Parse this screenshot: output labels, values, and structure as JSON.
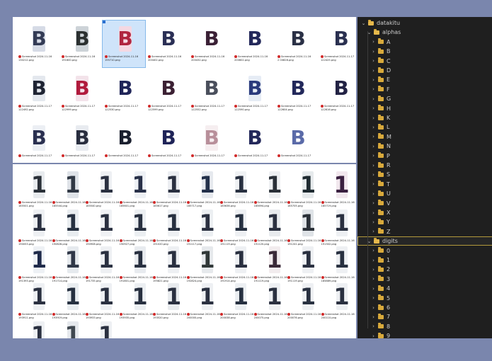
{
  "explorer": {
    "top_pane": {
      "rows": [
        {
          "items": [
            {
              "glyph": "B",
              "caption": [
                "Screenshot 2024-11-16",
                "130212.png"
              ],
              "bg": "#d6dbe6",
              "fg": "#333b55"
            },
            {
              "glyph": "B",
              "caption": [
                "Screenshot 2024-11-16",
                "191600.png"
              ],
              "bg": "#cdd3d8",
              "fg": "#2b3030"
            },
            {
              "glyph": "B",
              "caption": [
                "Screenshot 2024-11-16",
                "195710.png"
              ],
              "bg": "#f4d8e2",
              "fg": "#b0243f"
            },
            {
              "glyph": "B",
              "caption": [
                "Screenshot 2024-11-16",
                "200402.png"
              ],
              "bg": "#ffffff",
              "fg": "#2a2f55"
            },
            {
              "glyph": "B",
              "caption": [
                "Screenshot 2024-11-16",
                "200432.png"
              ],
              "bg": "#ffffff",
              "fg": "#3a2035"
            },
            {
              "glyph": "B",
              "caption": [
                "Screenshot 2024-11-16",
                "200602.png"
              ],
              "bg": "#ffffff",
              "fg": "#23285a"
            },
            {
              "glyph": "B",
              "caption": [
                "Screenshot 2024-11-16",
                "2 00828.png"
              ],
              "bg": "#ffffff",
              "fg": "#2a3045"
            },
            {
              "glyph": "B",
              "caption": [
                "Screenshot 2024-11-17",
                "122425.png"
              ],
              "bg": "#ffffff",
              "fg": "#2a3050"
            }
          ]
        },
        {
          "items": [
            {
              "glyph": "B",
              "caption": [
                "Screenshot 2024-11-17",
                "122492.png"
              ],
              "bg": "#e4e8ee",
              "fg": "#1f2433"
            },
            {
              "glyph": "B",
              "caption": [
                "Screenshot 2024-11-17",
                "122999.png"
              ],
              "bg": "#f3e3ea",
              "fg": "#b01a3c"
            },
            {
              "glyph": "B",
              "caption": [
                "Screenshot 2024-11-17",
                "122530.png"
              ],
              "bg": "#ffffff",
              "fg": "#1f2458"
            },
            {
              "glyph": "B",
              "caption": [
                "Screenshot 2024-11-17",
                "122599.png"
              ],
              "bg": "#ffffff",
              "fg": "#3b2033"
            },
            {
              "glyph": "B",
              "caption": [
                "Screenshot 2024-11-17",
                "122552.png"
              ],
              "bg": "#ffffff",
              "fg": "#4a4f5c"
            },
            {
              "glyph": "B",
              "caption": [
                "Screenshot 2024-11-17",
                "122590.png"
              ],
              "bg": "#e6ecf5",
              "fg": "#2a3a7c"
            },
            {
              "glyph": "B",
              "caption": [
                "Screenshot 2024-11-17",
                "122604.png"
              ],
              "bg": "#ffffff",
              "fg": "#22285a"
            },
            {
              "glyph": "B",
              "caption": [
                "Screenshot 2024-11-17",
                "122616.png"
              ],
              "bg": "#ffffff",
              "fg": "#222244"
            }
          ]
        },
        {
          "items": [
            {
              "glyph": "B",
              "caption": [
                "Screenshot 2024-11-17",
                ""
              ],
              "bg": "#eceff4",
              "fg": "#2a3050"
            },
            {
              "glyph": "B",
              "caption": [
                "Screenshot 2024-11-17",
                ""
              ],
              "bg": "#e8ebf0",
              "fg": "#282d3e"
            },
            {
              "glyph": "B",
              "caption": [
                "Screenshot 2024-11-17",
                ""
              ],
              "bg": "#ffffff",
              "fg": "#1a1f2e"
            },
            {
              "glyph": "B",
              "caption": [
                "Screenshot 2024-11-17",
                ""
              ],
              "bg": "#ffffff",
              "fg": "#1f2458"
            },
            {
              "glyph": "B",
              "caption": [
                "Screenshot 2024-11-17",
                ""
              ],
              "bg": "#f6eef0",
              "fg": "#b88f9a"
            },
            {
              "glyph": "B",
              "caption": [
                "Screenshot 2024-11-17",
                ""
              ],
              "bg": "#ffffff",
              "fg": "#23285a"
            },
            {
              "glyph": "B",
              "caption": [
                "Screenshot 2024-11-17",
                ""
              ],
              "bg": "#ffffff",
              "fg": "#5a6aa8"
            }
          ]
        }
      ]
    },
    "bottom_pane": {
      "rows": [
        {
          "items": [
            {
              "glyph": "1",
              "caption": [
                "Screenshot 2024-11-16",
                "185501.png"
              ],
              "bg": "#e8ebee",
              "fg": "#2a3038"
            },
            {
              "glyph": "1",
              "caption": [
                "Screenshot 2024-11-16",
                "185544.png"
              ],
              "bg": "#dfe3e8",
              "fg": "#303844"
            },
            {
              "glyph": "1",
              "caption": [
                "Screenshot 2024-11-16",
                "185540.png"
              ],
              "bg": "#eef0f3",
              "fg": "#2a3040"
            },
            {
              "glyph": "1",
              "caption": [
                "Screenshot 2024-11-16",
                "185601.png"
              ],
              "bg": "#eef1f5",
              "fg": "#283048"
            },
            {
              "glyph": "1",
              "caption": [
                "Screenshot 2024-11-16",
                "185617.png"
              ],
              "bg": "#eceef2",
              "fg": "#2a3040"
            },
            {
              "glyph": "1",
              "caption": [
                "Screenshot 2024-11-16",
                "185717.png"
              ],
              "bg": "#e6e9ee",
              "fg": "#23304a"
            },
            {
              "glyph": "1",
              "caption": [
                "Screenshot 2024-11-16",
                "185636.png"
              ],
              "bg": "#f0f2f4",
              "fg": "#283040"
            },
            {
              "glyph": "1",
              "caption": [
                "Screenshot 2024-11-16",
                "185694.png"
              ],
              "bg": "#eef0f3",
              "fg": "#2a3038"
            },
            {
              "glyph": "1",
              "caption": [
                "Screenshot 2024-11-16",
                "185705.png"
              ],
              "bg": "#e6eaec",
              "fg": "#1e2a30"
            },
            {
              "glyph": "1",
              "caption": [
                "Screenshot 2024-11-16",
                "185719.png"
              ],
              "bg": "#f2e8ee",
              "fg": "#3a2040"
            }
          ]
        },
        {
          "items": [
            {
              "glyph": "1",
              "caption": [
                "Screenshot 2024-11-16",
                "190053.png"
              ],
              "bg": "#eef0f3",
              "fg": "#2a3040"
            },
            {
              "glyph": "1",
              "caption": [
                "Screenshot 2024-11-16",
                "190828.png"
              ],
              "bg": "#e9edf0",
              "fg": "#263040"
            },
            {
              "glyph": "1",
              "caption": [
                "Screenshot 2024-11-16",
                "190908.png"
              ],
              "bg": "#f0f2f5",
              "fg": "#2a3040"
            },
            {
              "glyph": "1",
              "caption": [
                "Screenshot 2024-11-16",
                "190927.png"
              ],
              "bg": "#eceff2",
              "fg": "#283040"
            },
            {
              "glyph": "1",
              "caption": [
                "Screenshot 2024-11-16",
                "191020.png"
              ],
              "bg": "#eef0f3",
              "fg": "#283040"
            },
            {
              "glyph": "1",
              "caption": [
                "Screenshot 2024-11-16",
                "191117.png"
              ],
              "bg": "#eceff2",
              "fg": "#2a3040"
            },
            {
              "glyph": "1",
              "caption": [
                "Screenshot 2024-11-16",
                "191119.png"
              ],
              "bg": "#eef0f3",
              "fg": "#263040"
            },
            {
              "glyph": "1",
              "caption": [
                "Screenshot 2024-11-16",
                "191120.png"
              ],
              "bg": "#e8ebee",
              "fg": "#2a3040"
            },
            {
              "glyph": "1",
              "caption": [
                "Screenshot 2024-11-16",
                "191241.png"
              ],
              "bg": "#dfe3e7",
              "fg": "#2a3038"
            },
            {
              "glyph": "1",
              "caption": [
                "Screenshot 2024-11-16",
                "191302.png"
              ],
              "bg": "#eef0f3",
              "fg": "#2a3040"
            }
          ]
        },
        {
          "items": [
            {
              "glyph": "1",
              "caption": [
                "Screenshot 2024-11-16",
                "191393.png"
              ],
              "bg": "#eef1f5",
              "fg": "#1f2a4a"
            },
            {
              "glyph": "1",
              "caption": [
                "Screenshot 2024-11-16",
                "191714.png"
              ],
              "bg": "#e6eaee",
              "fg": "#303848"
            },
            {
              "glyph": "1",
              "caption": [
                "Screenshot 2024-11-16",
                "191735.png"
              ],
              "bg": "#eef0f3",
              "fg": "#2a3040"
            },
            {
              "glyph": "1",
              "caption": [
                "Screenshot 2024-11-16",
                "191801.png"
              ],
              "bg": "#e8ebef",
              "fg": "#283040"
            },
            {
              "glyph": "1",
              "caption": [
                "Screenshot 2024-11-16",
                "195821.png"
              ],
              "bg": "#eef0f3",
              "fg": "#2a3040"
            },
            {
              "glyph": "1",
              "caption": [
                "Screenshot 2024-11-16",
                "192824.png"
              ],
              "bg": "#e6e9ec",
              "fg": "#303838"
            },
            {
              "glyph": "1",
              "caption": [
                "Screenshot 2024-11-16",
                "191914.png"
              ],
              "bg": "#eef0f3",
              "fg": "#2a3040"
            },
            {
              "glyph": "1",
              "caption": [
                "Screenshot 2024-11-16",
                "191119.png"
              ],
              "bg": "#f2ecee",
              "fg": "#3a2a38"
            },
            {
              "glyph": "1",
              "caption": [
                "Screenshot 2024-11-16",
                "191119.png"
              ],
              "bg": "#eef0f3",
              "fg": "#2a3040"
            },
            {
              "glyph": "1",
              "caption": [
                "Screenshot 2024-11-16",
                "185889.png"
              ],
              "bg": "#eef0f3",
              "fg": "#283040"
            }
          ]
        },
        {
          "items": [
            {
              "glyph": "1",
              "caption": [
                "Screenshot 2024-11-16",
                "193911.png"
              ],
              "bg": "#eef0f3",
              "fg": "#2a3040"
            },
            {
              "glyph": "1",
              "caption": [
                "Screenshot 2024-11-16",
                "193919.png"
              ],
              "bg": "#e9edf0",
              "fg": "#263040"
            },
            {
              "glyph": "1",
              "caption": [
                "Screenshot 2024-11-16",
                "193933.png"
              ],
              "bg": "#eef0f3",
              "fg": "#2a3040"
            },
            {
              "glyph": "1",
              "caption": [
                "Screenshot 2024-11-16",
                "193935.png"
              ],
              "bg": "#eceff2",
              "fg": "#283040"
            },
            {
              "glyph": "1",
              "caption": [
                "Screenshot 2024-11-16",
                "193520.png"
              ],
              "bg": "#e8ebee",
              "fg": "#2a3040"
            },
            {
              "glyph": "1",
              "caption": [
                "Screenshot 2024-11-16",
                "200000.png"
              ],
              "bg": "#eef0f3",
              "fg": "#2a3040"
            },
            {
              "glyph": "1",
              "caption": [
                "Screenshot 2024-11-16",
                "200038.png"
              ],
              "bg": "#eceff2",
              "fg": "#263040"
            },
            {
              "glyph": "1",
              "caption": [
                "Screenshot 2024-11-16",
                "200075.png"
              ],
              "bg": "#eef0f3",
              "fg": "#2a3040"
            },
            {
              "glyph": "1",
              "caption": [
                "Screenshot 2024-11-16",
                "200076.png"
              ],
              "bg": "#eef0f3",
              "fg": "#283040"
            },
            {
              "glyph": "1",
              "caption": [
                "Screenshot 2024-11-16",
                "200110.png"
              ],
              "bg": "#eef0f3",
              "fg": "#2a3040"
            }
          ]
        },
        {
          "items": [
            {
              "glyph": "1",
              "caption": [
                "",
                ""
              ],
              "bg": "#eef0f3",
              "fg": "#2a3040"
            },
            {
              "glyph": "1",
              "caption": [
                "",
                ""
              ],
              "bg": "#e6e9ed",
              "fg": "#404850"
            },
            {
              "glyph": "1",
              "caption": [
                "",
                ""
              ],
              "bg": "#eef0f3",
              "fg": "#2a3040"
            }
          ]
        }
      ]
    }
  },
  "tree": {
    "root": "datakitu",
    "alphas_label": "alphas",
    "alphas": [
      "A",
      "B",
      "C",
      "D",
      "E",
      "F",
      "G",
      "H",
      "K",
      "L",
      "M",
      "N",
      "P",
      "R",
      "S",
      "T",
      "U",
      "V",
      "X",
      "Y",
      "Z"
    ],
    "digits_label": "digits",
    "digits": [
      "0",
      "1",
      "2",
      "3",
      "4",
      "5",
      "6",
      "7",
      "8",
      "9"
    ]
  },
  "colors": {
    "accent_outline": "#b39a3c",
    "folder": "#d8a93b",
    "selection": "#cfe4fa"
  }
}
